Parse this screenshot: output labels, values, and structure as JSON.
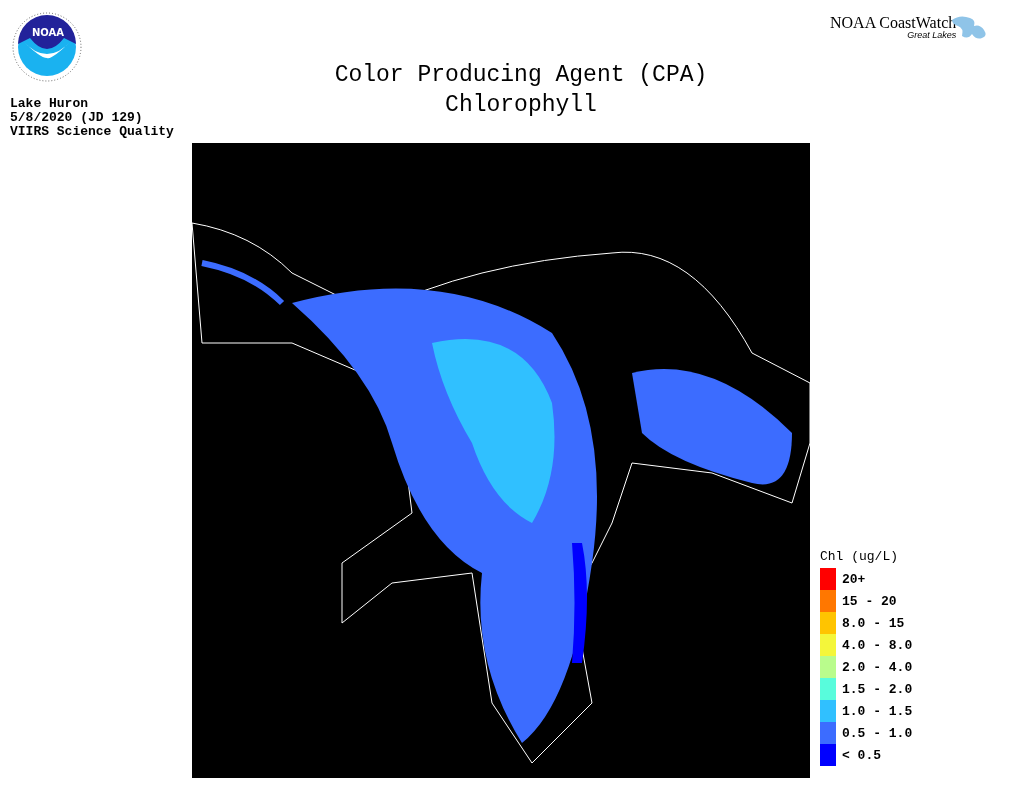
{
  "logo": {
    "text": "NOAA"
  },
  "title": [
    "Color Producing Agent (CPA)",
    "Chlorophyll"
  ],
  "info": [
    "Lake Huron",
    "5/8/2020 (JD 129)",
    "VIIRS Science Quality"
  ],
  "brand": {
    "name": "NOAA CoastWatch",
    "subtitle": "Great Lakes"
  },
  "legend": {
    "title": "Chl (ug/L)",
    "items": [
      {
        "label": "20+",
        "color": "#ff0000"
      },
      {
        "label": "15 - 20",
        "color": "#ff7700"
      },
      {
        "label": "8.0 - 15",
        "color": "#ffc400"
      },
      {
        "label": "4.0 - 8.0",
        "color": "#f4f63a"
      },
      {
        "label": "2.0 - 4.0",
        "color": "#b9fc8c"
      },
      {
        "label": "1.5 - 2.0",
        "color": "#58fcdc"
      },
      {
        "label": "1.0 - 1.5",
        "color": "#30c0ff"
      },
      {
        "label": "0.5 - 1.0",
        "color": "#3c6cff"
      },
      {
        "label": "< 0.5",
        "color": "#0000ff"
      }
    ]
  }
}
